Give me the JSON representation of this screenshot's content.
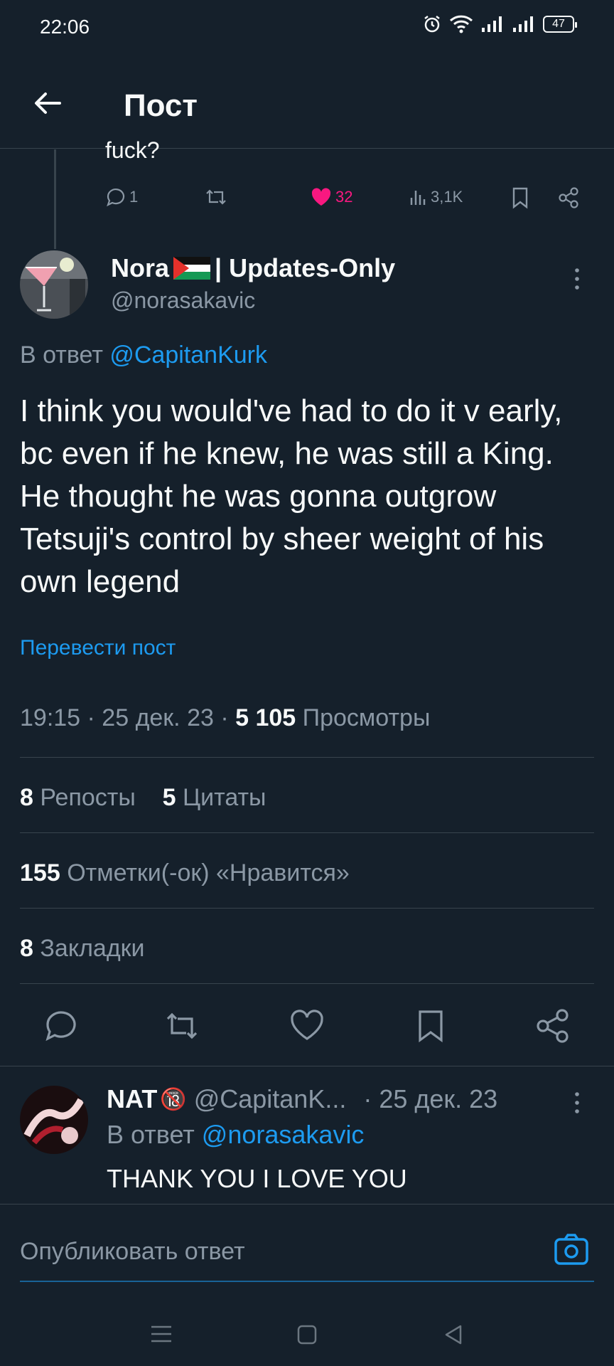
{
  "status_bar": {
    "time": "22:06",
    "battery": "47"
  },
  "header": {
    "title": "Пост"
  },
  "previous_tweet": {
    "snippet": "fuck?",
    "replies": "1",
    "likes": "32",
    "views": "3,1K"
  },
  "tweet": {
    "author_name": "Nora",
    "author_suffix": "| Updates-Only",
    "handle": "@norasakavic",
    "reply_prefix": "В ответ",
    "reply_handle": "@CapitanKurk",
    "text": "I think you would've had to do it v early, bc even if he knew, he was still a King. He thought he was gonna outgrow Tetsuji's control by sheer weight of his own legend",
    "translate": "Перевести пост",
    "time": "19:15 · 25 дек. 23 ·",
    "views_count": "5 105",
    "views_label": "Просмотры",
    "reposts_count": "8",
    "reposts_label": "Репосты",
    "quotes_count": "5",
    "quotes_label": "Цитаты",
    "likes_count": "155",
    "likes_label": "Отметки(-ок) «Нравится»",
    "bookmarks_count": "8",
    "bookmarks_label": "Закладки"
  },
  "reply": {
    "name": "NAT",
    "badge": "🔞",
    "handle": "@CapitanK...",
    "date": "· 25 дек. 23",
    "reply_prefix": "В ответ",
    "reply_handle": "@norasakavic",
    "text": "THANK YOU I LOVE YOU"
  },
  "compose": {
    "placeholder": "Опубликовать ответ"
  },
  "colors": {
    "background": "#15202b",
    "accent": "#1d9bf0",
    "like": "#f91880",
    "muted": "#8b98a5"
  }
}
